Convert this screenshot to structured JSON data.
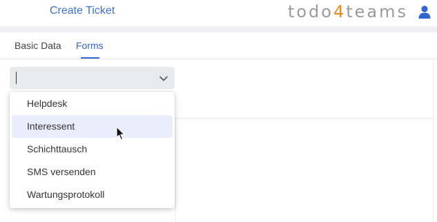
{
  "header": {
    "link_label": "Create Ticket",
    "brand": {
      "prefix": "todo",
      "accent": "4",
      "suffix": "teams"
    },
    "icon": "user-icon"
  },
  "tabs": [
    {
      "label": "Basic Data",
      "active": false
    },
    {
      "label": "Forms",
      "active": true
    }
  ],
  "select": {
    "value": "",
    "icon": "chevron-down-icon"
  },
  "dropdown": {
    "options": [
      {
        "label": "Helpdesk",
        "highlighted": false
      },
      {
        "label": "Interessent",
        "highlighted": true
      },
      {
        "label": "Schichttausch",
        "highlighted": false
      },
      {
        "label": "SMS versenden",
        "highlighted": false
      },
      {
        "label": "Wartungsprotokoll",
        "highlighted": false
      }
    ]
  },
  "colors": {
    "accent_blue": "#2f66d0",
    "brand_orange": "#e8891c",
    "brand_gray": "#9a9a9a",
    "highlight": "#e8eefc"
  }
}
